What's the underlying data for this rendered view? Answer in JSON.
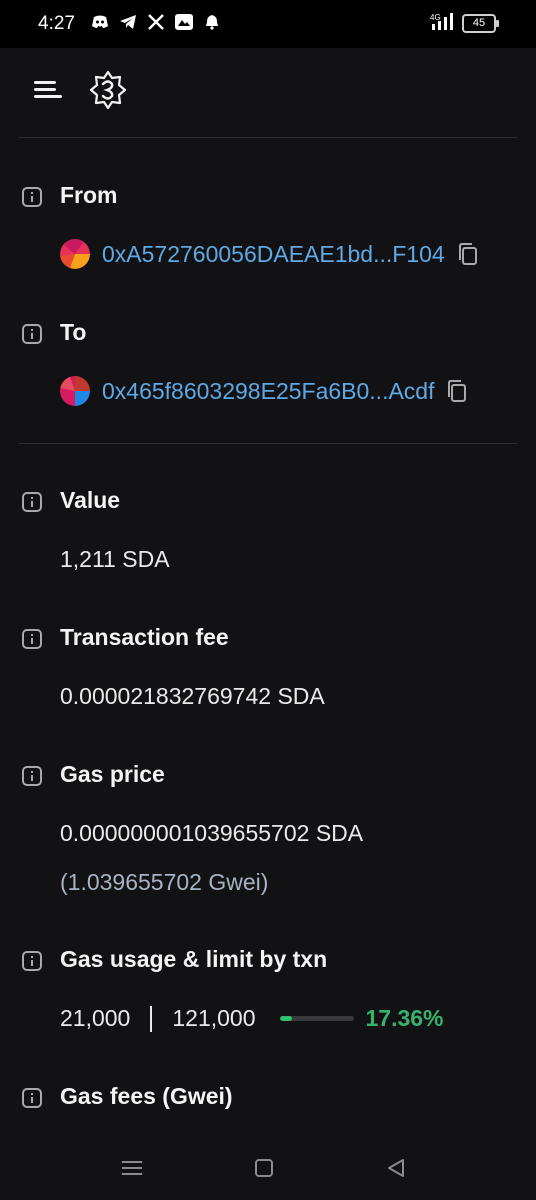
{
  "status_bar": {
    "time": "4:27",
    "notification_icons": [
      "discord-icon",
      "telegram-icon",
      "x-icon",
      "image-icon",
      "bell-icon"
    ],
    "network": "4G",
    "battery": "45"
  },
  "topbar": {
    "menu_icon": "hamburger-menu-icon",
    "logo_icon": "app-logo-icon"
  },
  "from": {
    "label": "From",
    "address": "0xA572760056DAEAE1bd...F104"
  },
  "to": {
    "label": "To",
    "address": "0x465f8603298E25Fa6B0...Acdf"
  },
  "value": {
    "label": "Value",
    "amount": "1,211 SDA"
  },
  "transaction_fee": {
    "label": "Transaction fee",
    "amount": "0.000021832769742 SDA"
  },
  "gas_price": {
    "label": "Gas price",
    "amount": "0.000000001039655702 SDA",
    "gwei": "(1.039655702 Gwei)"
  },
  "gas_usage": {
    "label": "Gas usage & limit by txn",
    "used": "21,000",
    "limit": "121,000",
    "percent": "17.36%",
    "fill_fraction": 0.1736
  },
  "gas_fees": {
    "label": "Gas fees (Gwei)"
  },
  "colors": {
    "background": "#121214",
    "address_link": "#5ea9e6",
    "percent_green": "#36b26e"
  }
}
